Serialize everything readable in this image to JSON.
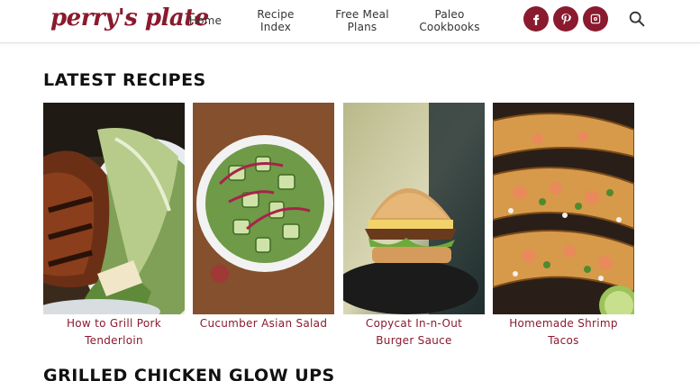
{
  "header": {
    "logo_text": "perry's plate",
    "nav": [
      {
        "label": "Home"
      },
      {
        "label": "Recipe\nIndex"
      },
      {
        "label": "Free Meal\nPlans"
      },
      {
        "label": "Paleo\nCookbooks"
      }
    ],
    "social_icons": [
      "facebook-icon",
      "pinterest-icon",
      "instagram-icon"
    ],
    "search_icon": "search-icon",
    "brand_color": "#8a1a2e"
  },
  "latest": {
    "title": "LATEST RECIPES",
    "recipes": [
      {
        "title": "How to Grill Pork Tenderloin"
      },
      {
        "title": "Cucumber Asian Salad"
      },
      {
        "title": "Copycat In-n-Out Burger Sauce"
      },
      {
        "title": "Homemade Shrimp Tacos"
      }
    ]
  },
  "next_section": {
    "title": "GRILLED CHICKEN GLOW UPS"
  }
}
